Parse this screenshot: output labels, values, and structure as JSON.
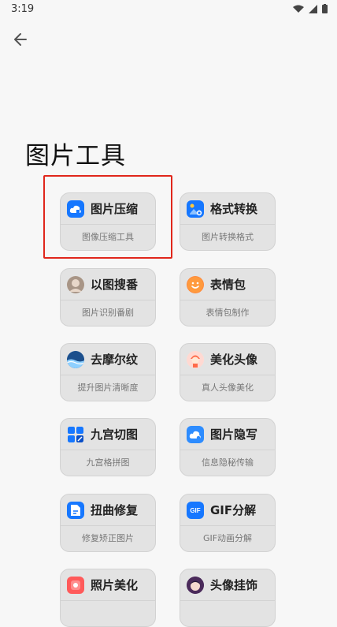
{
  "status": {
    "time": "3:19"
  },
  "page": {
    "title": "图片工具"
  },
  "tools": [
    {
      "name": "图片压缩",
      "desc": "图像压缩工具",
      "icon": "cloud-compress-icon"
    },
    {
      "name": "格式转换",
      "desc": "图片转换格式",
      "icon": "image-convert-icon"
    },
    {
      "name": "以图搜番",
      "desc": "图片识别番剧",
      "icon": "avatar-search-icon"
    },
    {
      "name": "表情包",
      "desc": "表情包制作",
      "icon": "emoji-face-icon"
    },
    {
      "name": "去摩尔纹",
      "desc": "提升图片清晰度",
      "icon": "wave-landscape-icon"
    },
    {
      "name": "美化头像",
      "desc": "真人头像美化",
      "icon": "person-face-icon"
    },
    {
      "name": "九宫切图",
      "desc": "九宫格拼图",
      "icon": "grid-cut-icon"
    },
    {
      "name": "图片隐写",
      "desc": "信息隐秘传输",
      "icon": "image-hide-icon"
    },
    {
      "name": "扭曲修复",
      "desc": "修复矫正图片",
      "icon": "document-fix-icon"
    },
    {
      "name": "GIF分解",
      "desc": "GIF动画分解",
      "icon": "gif-icon"
    },
    {
      "name": "照片美化",
      "desc": "",
      "icon": "photo-beauty-icon"
    },
    {
      "name": "头像挂饰",
      "desc": "",
      "icon": "anime-avatar-icon"
    }
  ],
  "colors": {
    "accent": "#1677ff",
    "highlight": "#e0261b"
  }
}
